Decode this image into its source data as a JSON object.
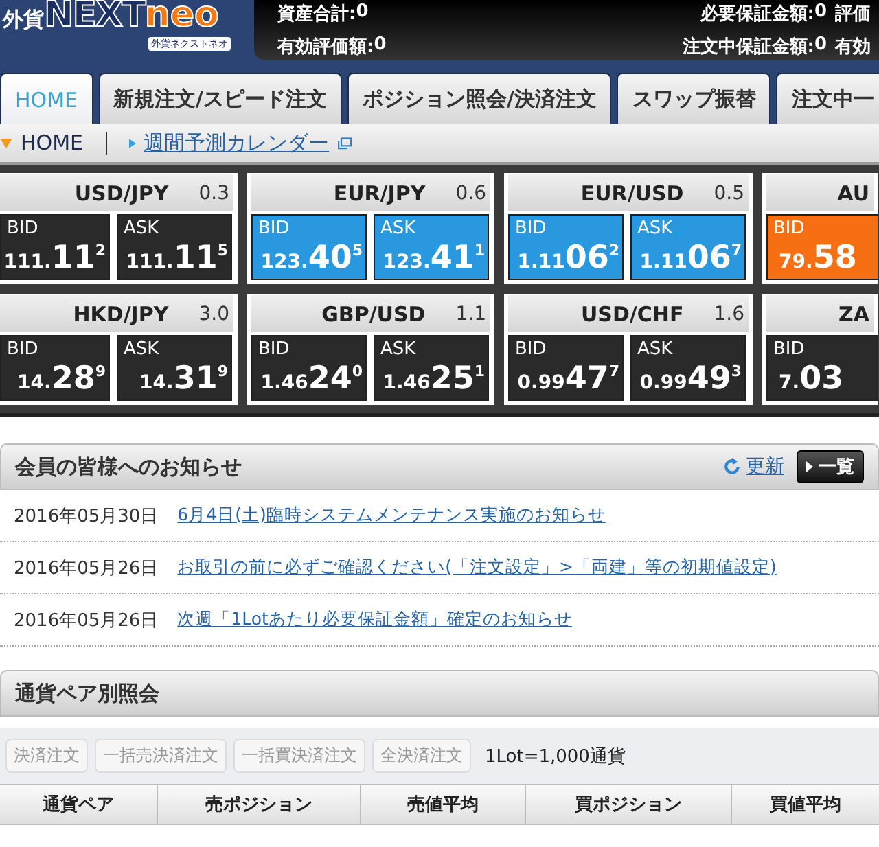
{
  "logo": {
    "prefix": "外貨",
    "main": "NEXT",
    "accent": "neo",
    "sub": "外貨ネクストネオ"
  },
  "account": [
    {
      "label": "資産合計:",
      "value": "0"
    },
    {
      "label": "必要保証金額:",
      "value": "0"
    },
    {
      "label": "評価"
    },
    {
      "label": "有効評価額:",
      "value": "0"
    },
    {
      "label": "注文中保証金額:",
      "value": "0"
    },
    {
      "label": "有効"
    }
  ],
  "tabs": [
    {
      "label": "HOME",
      "selected": true
    },
    {
      "label": "新規注文/スピード注文",
      "selected": false
    },
    {
      "label": "ポジション照会/決済注文",
      "selected": false
    },
    {
      "label": "スワップ振替",
      "selected": false
    },
    {
      "label": "注文中一",
      "selected": false
    }
  ],
  "breadcrumb": {
    "current": "HOME",
    "link": "週間予測カレンダー"
  },
  "quotes": [
    {
      "pair": "USD/JPY",
      "spread": "0.3",
      "color": "#2a2a2a",
      "bid": {
        "label": "BID",
        "small": "111.",
        "big": "11",
        "pip": "2"
      },
      "ask": {
        "label": "ASK",
        "small": "111.",
        "big": "11",
        "pip": "5"
      }
    },
    {
      "pair": "EUR/JPY",
      "spread": "0.6",
      "color": "#2a98de",
      "bid": {
        "label": "BID",
        "small": "123.",
        "big": "40",
        "pip": "5"
      },
      "ask": {
        "label": "ASK",
        "small": "123.",
        "big": "41",
        "pip": "1"
      }
    },
    {
      "pair": "EUR/USD",
      "spread": "0.5",
      "color": "#2a98de",
      "bid": {
        "label": "BID",
        "small": "1.11",
        "big": "06",
        "pip": "2"
      },
      "ask": {
        "label": "ASK",
        "small": "1.11",
        "big": "06",
        "pip": "7"
      }
    },
    {
      "pair": "AU",
      "color": "#f66f12",
      "bid": {
        "label": "BID",
        "small": "79.",
        "big": "58"
      }
    },
    {
      "pair": "HKD/JPY",
      "spread": "3.0",
      "color": "#2a2a2a",
      "bid": {
        "label": "BID",
        "small": "14.",
        "big": "28",
        "pip": "9"
      },
      "ask": {
        "label": "ASK",
        "small": "14.",
        "big": "31",
        "pip": "9"
      }
    },
    {
      "pair": "GBP/USD",
      "spread": "1.1",
      "color": "#2a2a2a",
      "bid": {
        "label": "BID",
        "small": "1.46",
        "big": "24",
        "pip": "0"
      },
      "ask": {
        "label": "ASK",
        "small": "1.46",
        "big": "25",
        "pip": "1"
      }
    },
    {
      "pair": "USD/CHF",
      "spread": "1.6",
      "color": "#2a2a2a",
      "bid": {
        "label": "BID",
        "small": "0.99",
        "big": "47",
        "pip": "7"
      },
      "ask": {
        "label": "ASK",
        "small": "0.99",
        "big": "49",
        "pip": "3"
      }
    },
    {
      "pair": "ZA",
      "color": "#2a2a2a",
      "bid": {
        "label": "BID",
        "small": "7.",
        "big": "03"
      }
    }
  ],
  "notices": {
    "title": "会員の皆様へのお知らせ",
    "refresh": "更新",
    "list_button": "一覧",
    "items": [
      {
        "date": "2016年05月30日",
        "text": "6月4日(土)臨時システムメンテナンス実施のお知らせ"
      },
      {
        "date": "2016年05月26日",
        "text": "お取引の前に必ずご確認ください(「注文設定」>「両建」等の初期値設定)"
      },
      {
        "date": "2016年05月26日",
        "text": "次週「1Lotあたり必要保証金額」確定のお知らせ"
      }
    ]
  },
  "positions": {
    "title": "通貨ペア別照会",
    "buttons": [
      {
        "label": "決済注文",
        "disabled": true
      },
      {
        "label": "一括売決済注文",
        "disabled": true
      },
      {
        "label": "一括買決済注文",
        "disabled": true
      },
      {
        "label": "全決済注文",
        "disabled": true
      }
    ],
    "lot_note": "1Lot=1,000通貨",
    "columns": [
      "通貨ペア",
      "売ポジション",
      "売値平均",
      "買ポジション",
      "買値平均"
    ]
  }
}
